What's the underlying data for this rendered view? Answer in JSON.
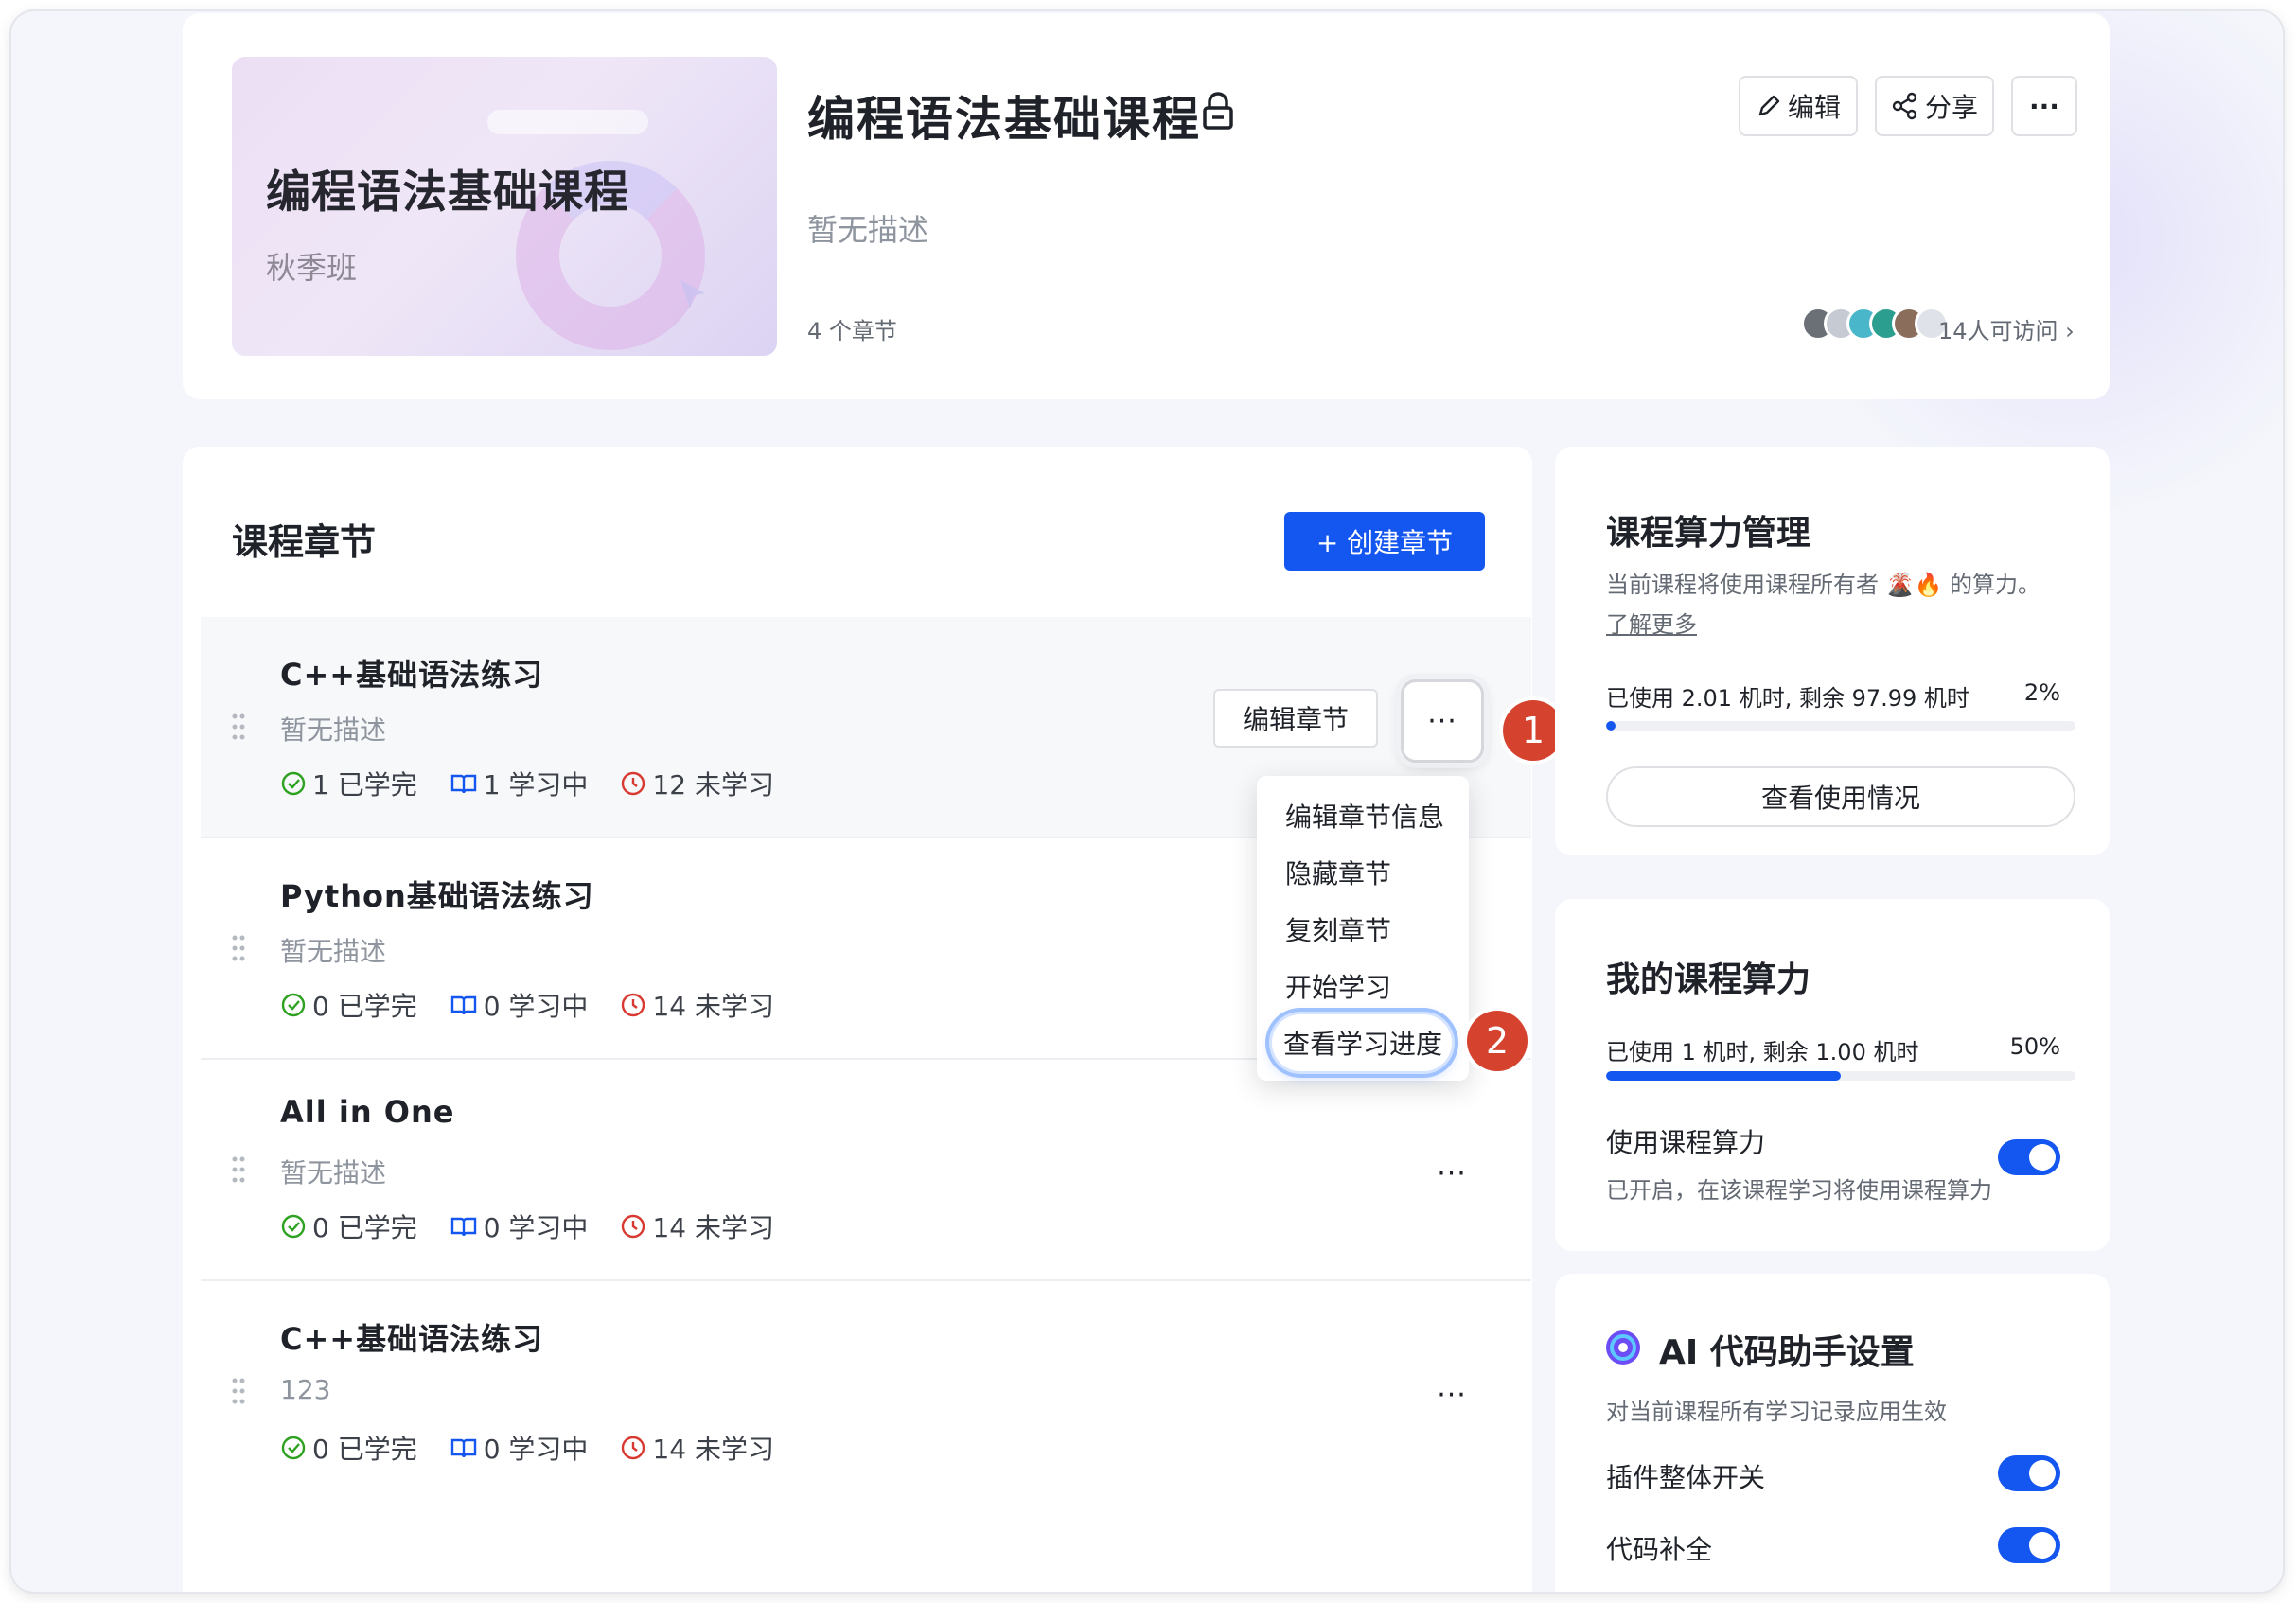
{
  "header": {
    "cover_title": "编程语法基础课程",
    "cover_subtitle": "秋季班",
    "title": "编程语法基础课程",
    "description": "暂无描述",
    "chapter_count": "4 个章节",
    "edit_label": "编辑",
    "share_label": "分享",
    "more_label": "···",
    "access_count": "14人可访问 ›"
  },
  "chapters": {
    "section_title": "课程章节",
    "create_label": "+ 创建章节",
    "edit_chapter_label": "编辑章节",
    "more_label": "···",
    "items": [
      {
        "title": "C++基础语法练习",
        "desc": "暂无描述",
        "done": "1 已学完",
        "learning": "1 学习中",
        "todo": "12 未学习"
      },
      {
        "title": "Python基础语法练习",
        "desc": "暂无描述",
        "done": "0 已学完",
        "learning": "0 学习中",
        "todo": "14 未学习"
      },
      {
        "title": "All in One",
        "desc": "暂无描述",
        "done": "0 已学完",
        "learning": "0 学习中",
        "todo": "14 未学习"
      },
      {
        "title": "C++基础语法练习",
        "desc": "123",
        "done": "0 已学完",
        "learning": "0 学习中",
        "todo": "14 未学习"
      }
    ]
  },
  "dropdown": {
    "items": [
      "编辑章节信息",
      "隐藏章节",
      "复刻章节",
      "开始学习",
      "查看学习进度"
    ]
  },
  "annotations": {
    "step1": "1",
    "step2": "2"
  },
  "course_power": {
    "title": "课程算力管理",
    "desc_prefix": "当前课程将使用课程所有者",
    "owner_emoji": "🌋🔥",
    "desc_suffix": "的算力。",
    "learn_more": "了解更多",
    "usage": "已使用 2.01 机时, 剩余 97.99 机时",
    "percent": "2%",
    "percent_value": 0.02,
    "view_usage": "查看使用情况"
  },
  "my_power": {
    "title": "我的课程算力",
    "usage": "已使用 1 机时, 剩余 1.00 机时",
    "percent": "50%",
    "percent_value": 0.5,
    "use_label": "使用课程算力",
    "use_desc": "已开启，在该课程学习将使用课程算力",
    "enabled": true
  },
  "ai_assistant": {
    "title": "AI 代码助手设置",
    "desc": "对当前课程所有学习记录应用生效",
    "plugin_toggle_label": "插件整体开关",
    "code_completion_label": "代码补全",
    "plugin_enabled": true,
    "completion_enabled": true
  },
  "colors": {
    "accent": "#1456f0",
    "badge": "#d5432f",
    "done": "#2ea121",
    "learning": "#1456f0",
    "todo": "#d83931"
  }
}
